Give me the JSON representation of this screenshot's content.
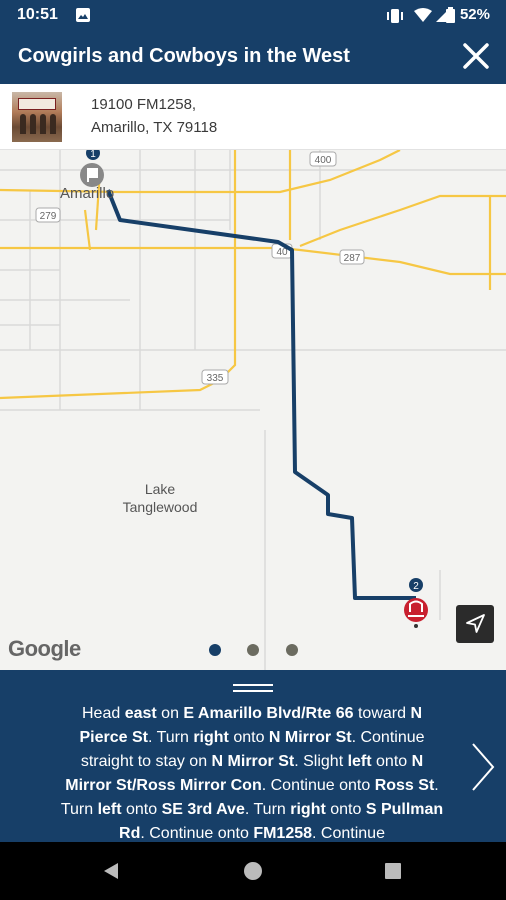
{
  "status": {
    "time": "10:51",
    "battery": "52%"
  },
  "header": {
    "title": "Cowgirls and Cowboys in the West"
  },
  "address": {
    "line1": "19100 FM1258,",
    "line2": "Amarillo, TX 79118"
  },
  "map": {
    "city": "Amarillo",
    "lake": "Lake Tanglewood",
    "highways": [
      "279",
      "400",
      "40",
      "287",
      "335"
    ],
    "start_marker": "1",
    "end_marker": "2",
    "attribution": "Google",
    "route_color": "#173f68",
    "road_color": "#f6c744"
  },
  "pager": {
    "count": 3,
    "active": 0
  },
  "directions": {
    "text_html": "Head <b>east</b> on <b>E Amarillo Blvd/Rte 66</b> toward <b>N Pierce St</b>. Turn <b>right</b> onto <b>N Mirror St</b>. Continue straight to stay on <b>N Mirror St</b>. Slight <b>left</b> onto <b>N Mirror St/Ross Mirror Con</b>. Continue onto <b>Ross St</b>. Turn <b>left</b> onto <b>SE 3rd Ave</b>. Turn <b>right</b> onto <b>S Pullman Rd</b>. Continue onto <b>FM1258</b>. Continue"
  },
  "icons": {
    "close": "close-icon",
    "next": "chevron-right-icon",
    "location": "navigation-arrow-icon",
    "back": "back-triangle-icon",
    "home": "home-circle-icon",
    "recents": "recents-square-icon"
  },
  "colors": {
    "brand": "#173f68",
    "marker_end": "#c8202f"
  }
}
